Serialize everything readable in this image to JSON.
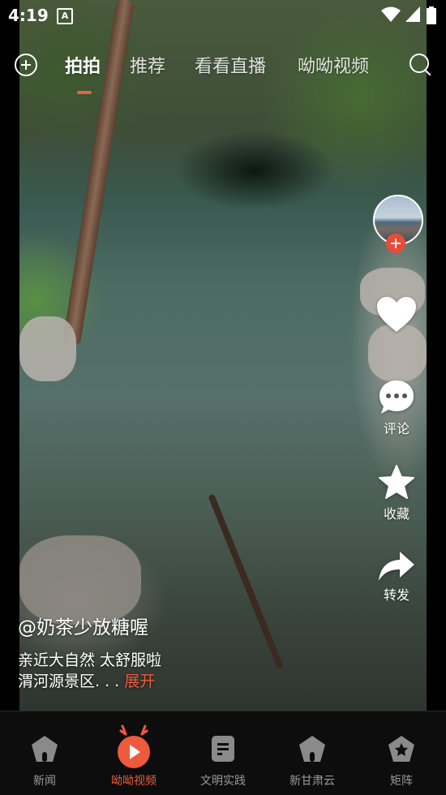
{
  "status": {
    "time": "4:19",
    "notification_glyph": "A"
  },
  "topnav": {
    "tabs": [
      {
        "label": "拍拍",
        "active": true
      },
      {
        "label": "推荐",
        "active": false
      },
      {
        "label": "看看直播",
        "active": false
      },
      {
        "label": "呦呦视频",
        "active": false
      }
    ]
  },
  "side": {
    "comment_label": "评论",
    "favorite_label": "收藏",
    "share_label": "转发"
  },
  "post": {
    "author": "@奶茶少放糖喔",
    "caption_line1": "亲近大自然 太舒服啦",
    "caption_line2": "渭河源景区. . . ",
    "expand_label": "展开"
  },
  "bottom_nav": {
    "items": [
      {
        "label": "新闻",
        "icon": "pentagon-icon",
        "active": false
      },
      {
        "label": "呦呦视频",
        "icon": "deer-play-icon",
        "active": true
      },
      {
        "label": "文明实践",
        "icon": "document-icon",
        "active": false
      },
      {
        "label": "新甘肃云",
        "icon": "pentagon-icon",
        "active": false
      },
      {
        "label": "矩阵",
        "icon": "star-badge-icon",
        "active": false
      }
    ]
  },
  "colors": {
    "accent": "#ef5a3c",
    "follow": "#e84b3a",
    "bar_bg": "#0d0d0d",
    "inactive": "#9a9a9a"
  }
}
